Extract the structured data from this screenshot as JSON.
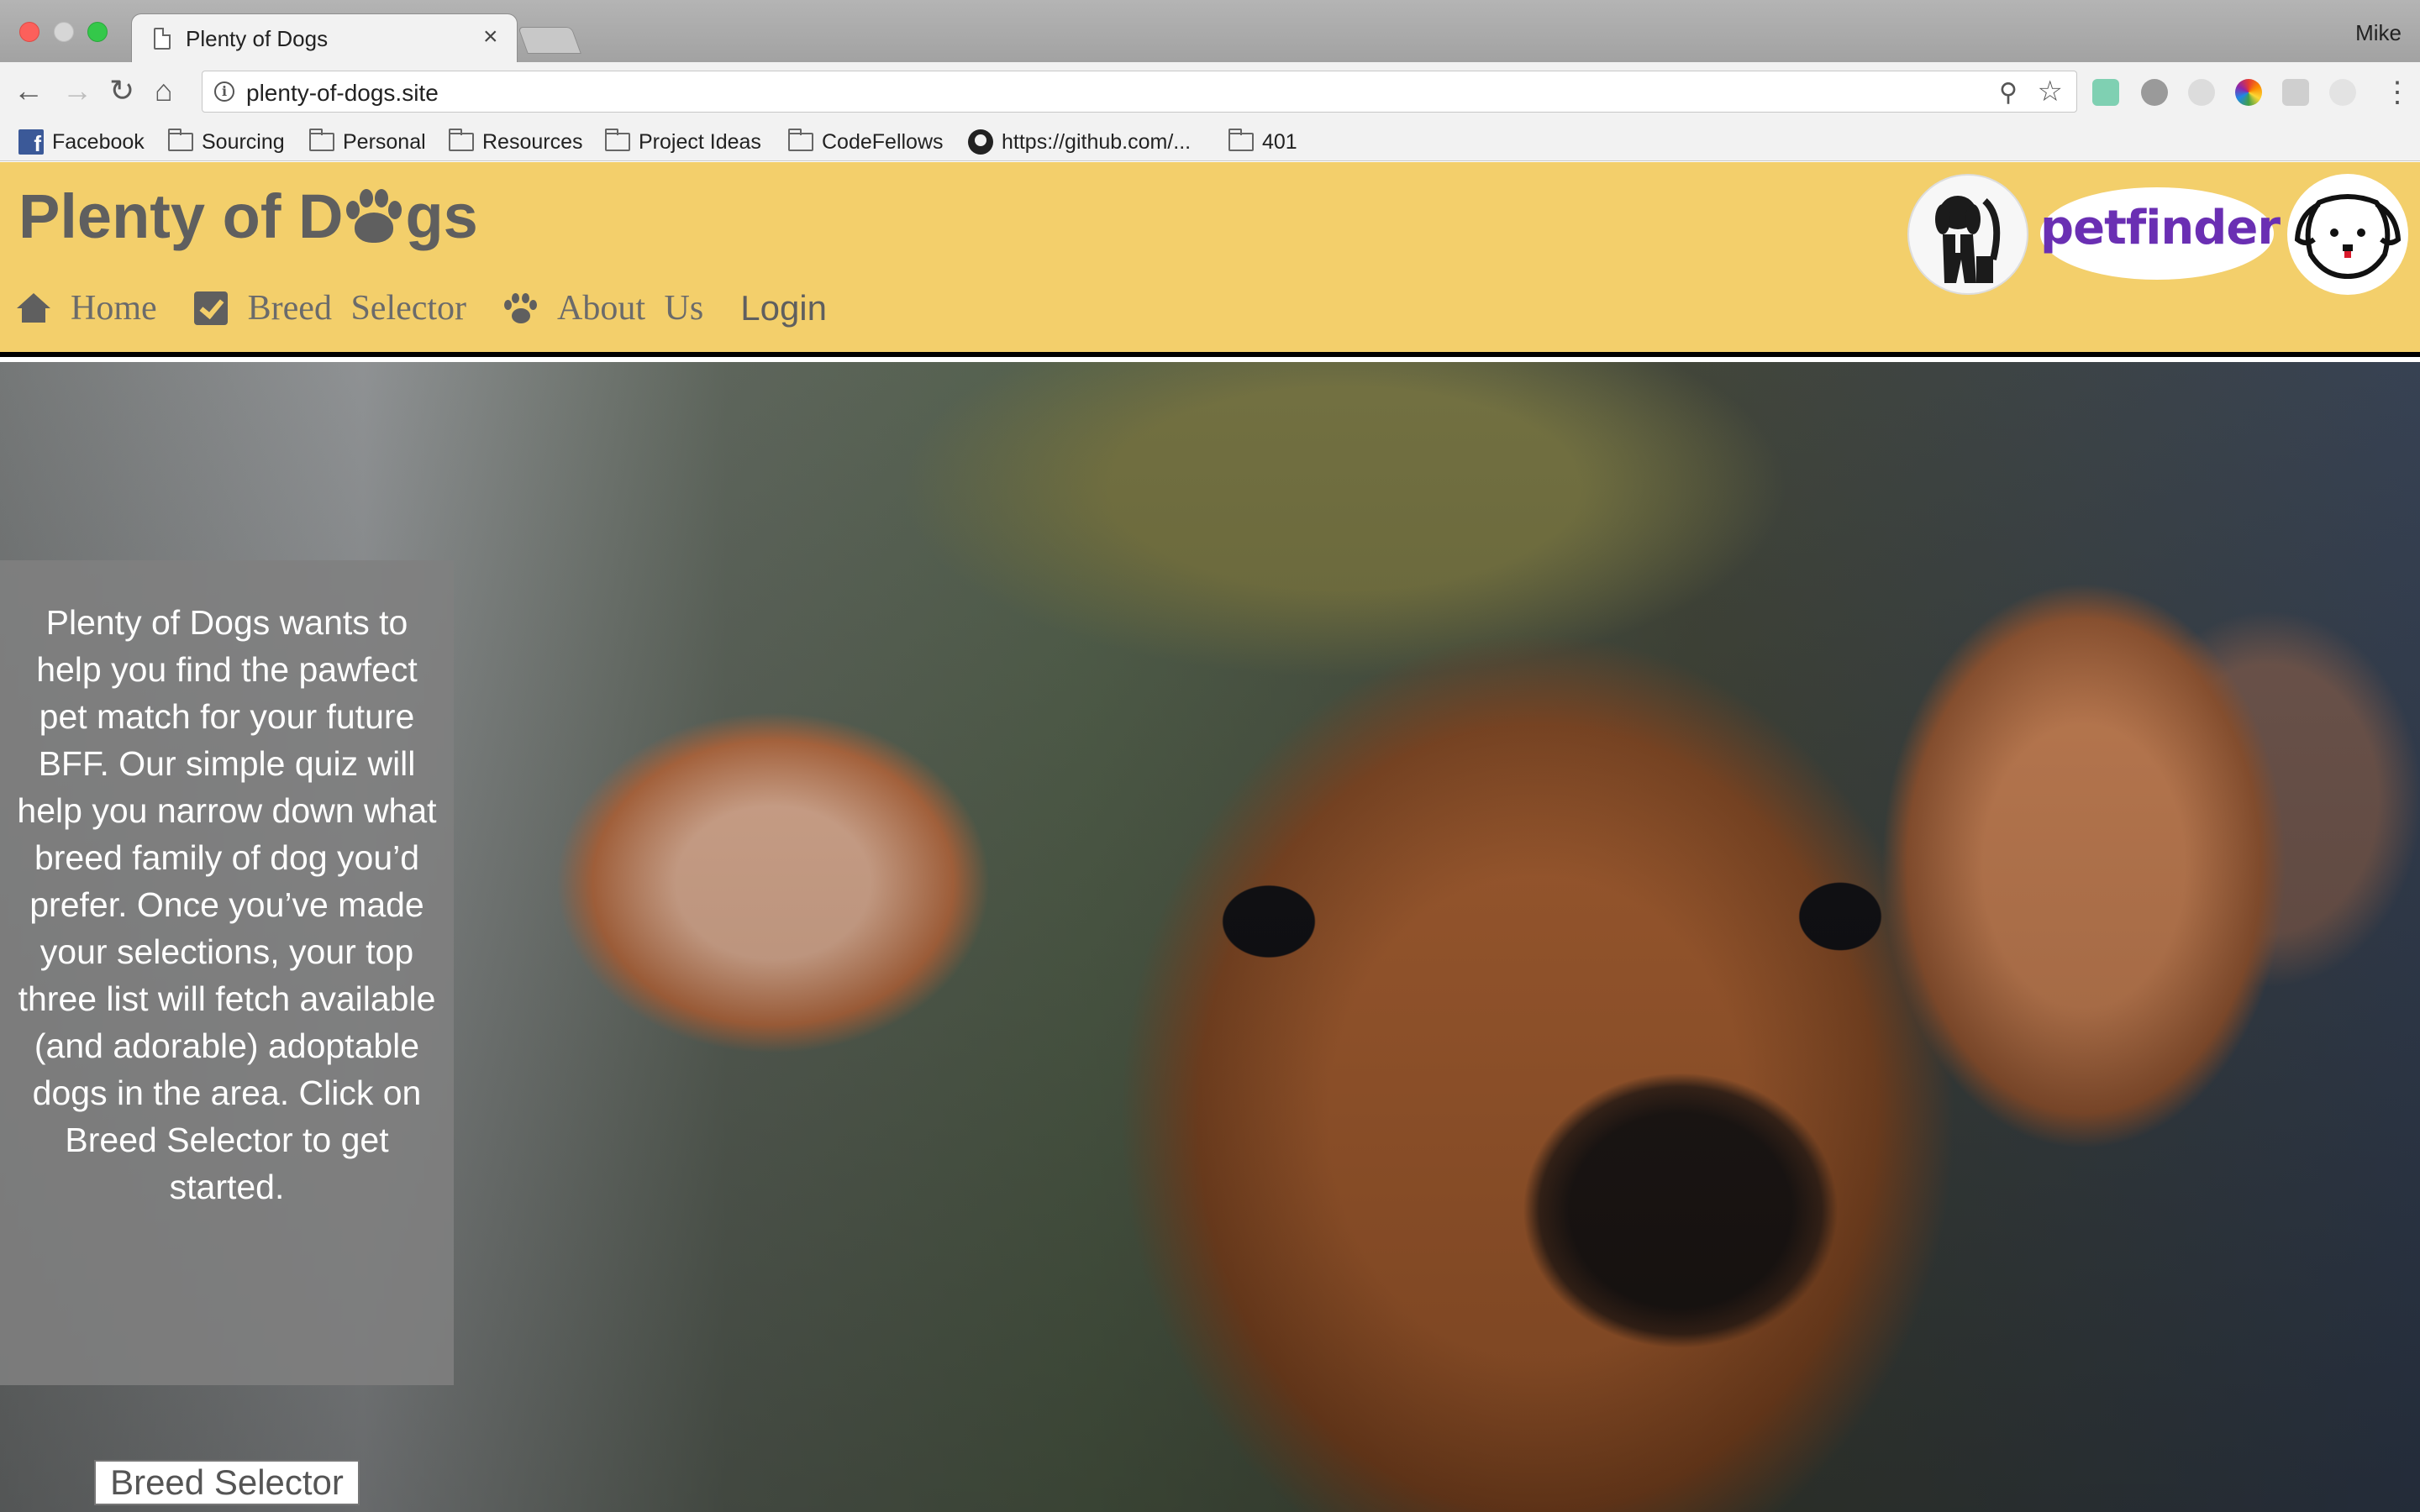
{
  "browser": {
    "tab_title": "Plenty of Dogs",
    "tab_close": "×",
    "profile_name": "Mike",
    "url": "plenty-of-dogs.site",
    "info_glyph": "i",
    "zoom_icon": "⚲",
    "star_icon": "☆",
    "back_icon": "←",
    "forward_icon": "→",
    "reload_icon": "↻",
    "home_icon": "⌂",
    "menu_icon": "⋮",
    "bookmarks": [
      "Facebook",
      "Sourcing",
      "Personal",
      "Resources",
      "Project Ideas",
      "CodeFellows",
      "https://github.com/...",
      "401"
    ]
  },
  "site": {
    "logo_part1": "Plenty of D",
    "logo_part2": "gs",
    "nav": {
      "home": "Home",
      "breed_selector": "Breed Selector",
      "about": "About Us",
      "login": "Login"
    },
    "partners": {
      "petfinder": "petfinder"
    },
    "intro": "Plenty of Dogs wants to help you find the pawfect pet match for your future BFF. Our simple quiz will help you narrow down what breed family of dog you’d prefer. Once you’ve made your selections, your top three list will fetch available (and adorable) adoptable dogs in the area. Click on Breed Selector to get started.",
    "cta_button": "Breed Selector"
  },
  "colors": {
    "header_bg": "#f3cf6b",
    "nav_text": "#6b6b6b",
    "petfinder_purple": "#6a2fb3"
  }
}
